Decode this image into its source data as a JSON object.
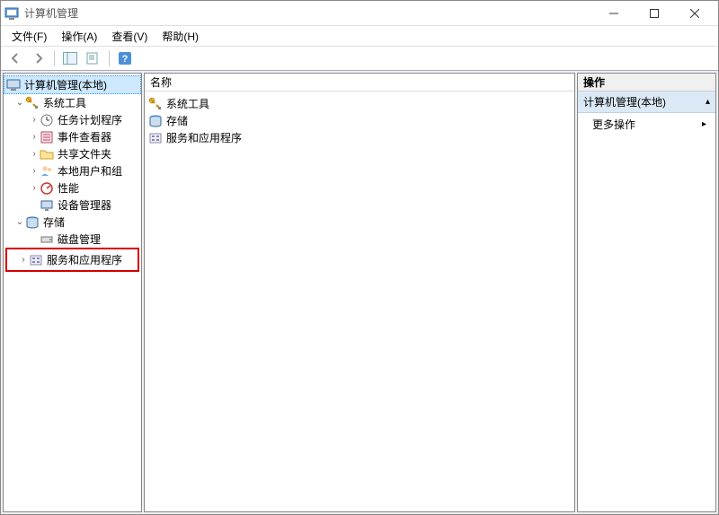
{
  "window": {
    "title": "计算机管理"
  },
  "menu": {
    "file": "文件(F)",
    "action": "操作(A)",
    "view": "查看(V)",
    "help": "帮助(H)"
  },
  "tree": {
    "root": "计算机管理(本地)",
    "system_tools": "系统工具",
    "task_scheduler": "任务计划程序",
    "event_viewer": "事件查看器",
    "shared_folders": "共享文件夹",
    "local_users": "本地用户和组",
    "performance": "性能",
    "device_manager": "设备管理器",
    "storage": "存储",
    "disk_management": "磁盘管理",
    "services_apps": "服务和应用程序"
  },
  "list": {
    "header_name": "名称",
    "item_system_tools": "系统工具",
    "item_storage": "存储",
    "item_services_apps": "服务和应用程序"
  },
  "actions": {
    "header": "操作",
    "context": "计算机管理(本地)",
    "more": "更多操作"
  }
}
